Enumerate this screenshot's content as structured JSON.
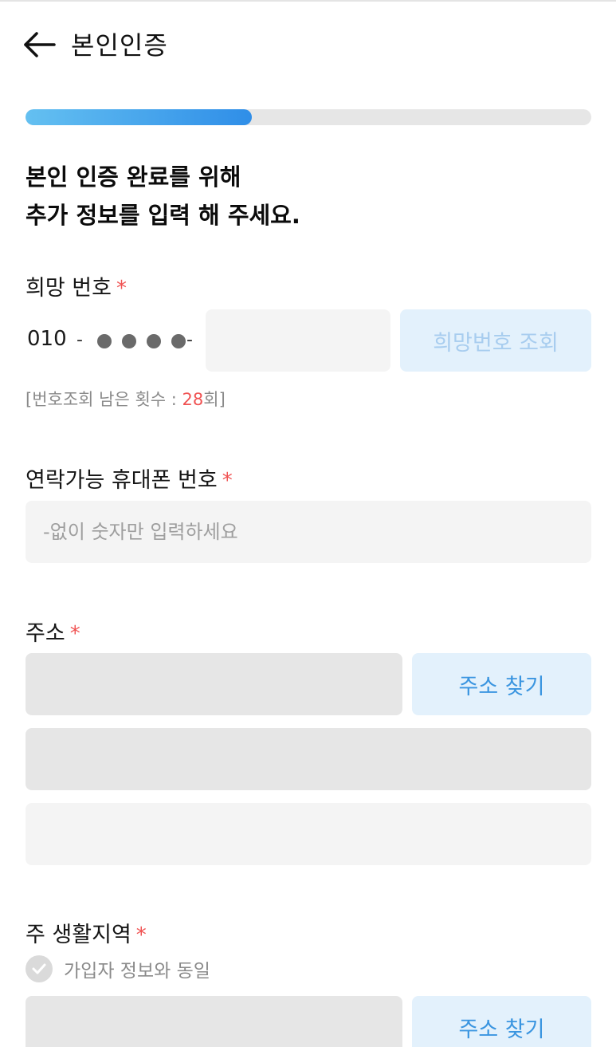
{
  "header": {
    "title": "본인인증",
    "back_icon": "arrow-left-icon"
  },
  "progress": {
    "fraction": 0.4
  },
  "headline": {
    "line1": "본인 인증 완료를 위해",
    "line2": "추가 정보를 입력 해 주세요."
  },
  "required_mark": "*",
  "wish_number": {
    "label": "희망 번호",
    "prefix": "010",
    "separator": "-",
    "masked_digits": 4,
    "input_value": "",
    "lookup_button": "희망번호 조회",
    "remaining_prefix": "[번호조회 남은 횟수 : ",
    "remaining_count": "28",
    "remaining_suffix": "회]"
  },
  "contact_phone": {
    "label": "연락가능 휴대폰 번호",
    "placeholder": "-없이 숫자만 입력하세요"
  },
  "address": {
    "label": "주소",
    "search_button": "주소 찾기"
  },
  "living_area": {
    "label": "주 생활지역",
    "same_as_member": "가입자 정보와 동일",
    "search_button": "주소 찾기"
  },
  "colors": {
    "accent": "#2f8ee8",
    "required": "#f05353",
    "button_bg": "#e3f1fc"
  }
}
